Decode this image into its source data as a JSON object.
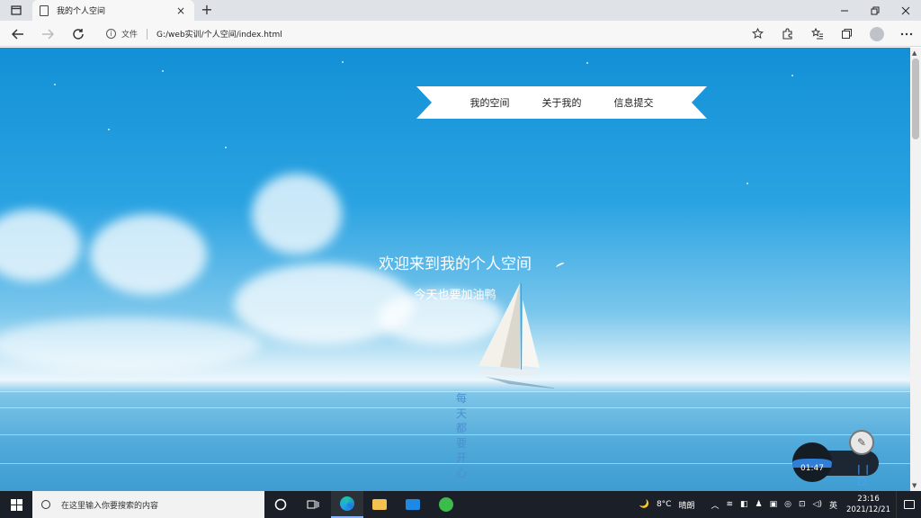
{
  "browser": {
    "tab_title": "我的个人空间",
    "tab_close": "×",
    "new_tab": "+",
    "address_scheme_label": "文件",
    "address_url": "G:/web实训/个人空间/index.html"
  },
  "page": {
    "nav_items": [
      "我的空间",
      "关于我的",
      "信息提交"
    ],
    "heading": "欢迎来到我的个人空间",
    "subheading": "今天也要加油鸭",
    "vertical_text": [
      "每",
      "天",
      "都",
      "要",
      "开",
      "心"
    ]
  },
  "media_widget": {
    "time": "01:47",
    "controls": "| | □"
  },
  "taskbar": {
    "search_placeholder": "在这里输入你要搜索的内容",
    "weather_temp": "8°C",
    "weather_desc": "晴朗",
    "ime": "英",
    "time": "23:16",
    "date": "2021/12/21"
  },
  "colors": {
    "sky_top": "#1390d6",
    "banner_bg": "#ffffff",
    "vertical_text": "#4b8fd0",
    "taskbar_bg": "#1b1f27"
  }
}
